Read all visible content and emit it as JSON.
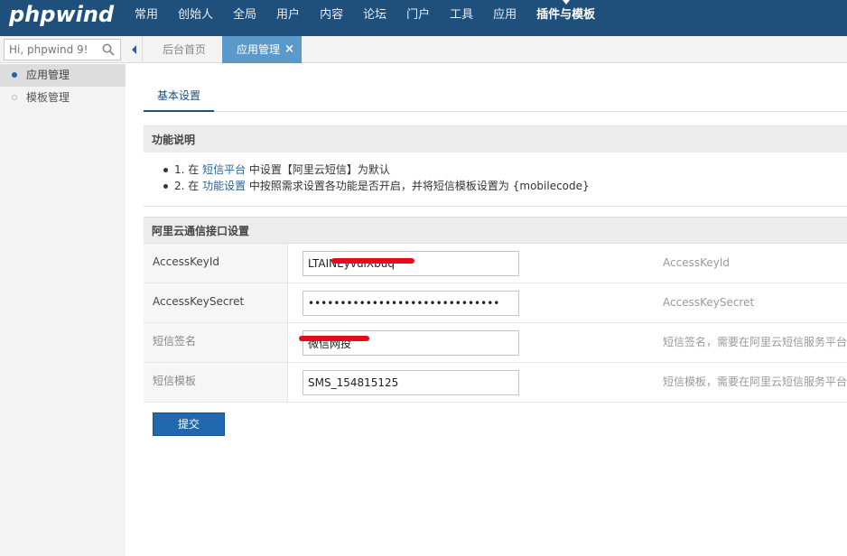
{
  "brand": {
    "logo_text": "phpwind"
  },
  "topnav": {
    "items": [
      "常用",
      "创始人",
      "全局",
      "用户",
      "内容",
      "论坛",
      "门户",
      "工具",
      "应用",
      "插件与模板"
    ],
    "active_index": 9
  },
  "subbar": {
    "search_placeholder": "Hi, phpwind 9!",
    "tabs": {
      "home": "后台首页",
      "app": "应用管理",
      "close": "×"
    }
  },
  "sidebar": {
    "items": [
      {
        "label": "应用管理",
        "active": true
      },
      {
        "label": "模板管理",
        "active": false
      }
    ]
  },
  "main": {
    "tab_label": "基本设置",
    "func_section": {
      "title": "功能说明",
      "notes": [
        {
          "prefix": "1. 在 ",
          "link": "短信平台",
          "suffix": " 中设置【阿里云短信】为默认"
        },
        {
          "prefix": "2. 在 ",
          "link": "功能设置",
          "suffix": " 中按照需求设置各功能是否开启，并将短信模板设置为 {mobilecode}"
        }
      ]
    },
    "config_section": {
      "title": "阿里云通信接口设置",
      "rows": [
        {
          "label": "AccessKeyId",
          "value": "LTAINEyvulXbuq",
          "hint": "AccessKeyId",
          "muted": false
        },
        {
          "label": "AccessKeySecret",
          "value": "••••••••••••••••••••••••••••••",
          "hint": "AccessKeySecret",
          "muted": false
        },
        {
          "label": "短信签名",
          "value": "微信网投",
          "hint": "短信签名，需要在阿里云短信服务平台",
          "muted": true
        },
        {
          "label": "短信模板",
          "value": "SMS_154815125",
          "hint": "短信模板，需要在阿里云短信服务平台",
          "muted": true
        }
      ]
    },
    "submit_label": "提交"
  },
  "colors": {
    "topbar": "#1f4f7b",
    "active_tab": "#5a99c9",
    "button": "#2268ae",
    "link": "#2a6496",
    "redaction": "#e8091a"
  }
}
